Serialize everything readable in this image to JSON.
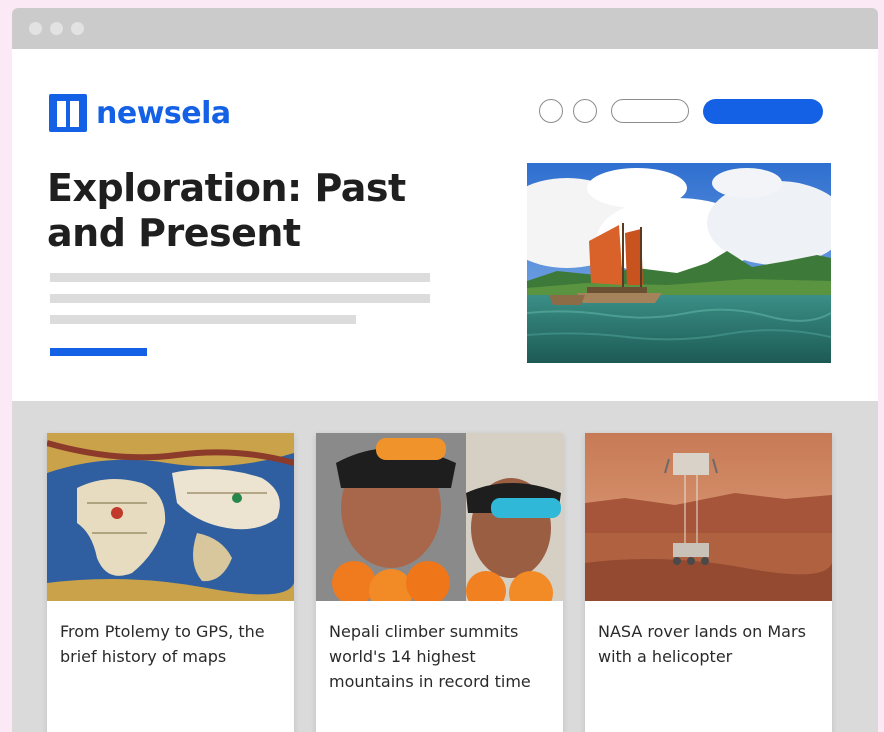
{
  "brand": {
    "name": "newsela",
    "color": "#1461e6"
  },
  "hero": {
    "title": "Exploration: Past and Present",
    "image": "voyaging-canoe-photo"
  },
  "articles": [
    {
      "title": "From Ptolemy to GPS, the brief history of maps",
      "image": "antique-world-map"
    },
    {
      "title": "Nepali climber summits world's 14 highest mountains in record time",
      "image": "climbers-with-garlands"
    },
    {
      "title": "NASA rover lands on Mars with a helicopter",
      "image": "mars-rover-descent"
    }
  ]
}
